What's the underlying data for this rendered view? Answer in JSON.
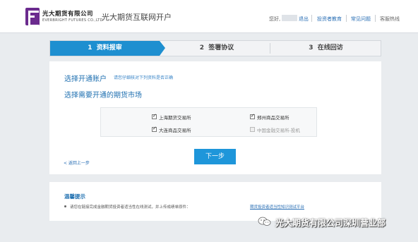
{
  "header": {
    "logo_cn": "光大期货有限公司",
    "logo_en": "EVERBRIGHT FUTURES CO.,LTD",
    "site_title": "光大期货互联网开户",
    "greeting": "您好,",
    "logout": "退出",
    "investor_edu": "投资者教育",
    "faq": "常见问题",
    "hotline": "客服热线"
  },
  "steps": [
    {
      "num": "1",
      "label": "资料报审",
      "active": true
    },
    {
      "num": "2",
      "label": "签署协议",
      "active": false
    },
    {
      "num": "3",
      "label": "在线回访",
      "active": false
    }
  ],
  "main": {
    "select_account_title": "选择开通账户",
    "select_account_hint": "请您仔细核对下列资料是否正确",
    "market_title": "选择需要开通的期货市场",
    "markets": [
      {
        "label": "上海期货交易所",
        "checked": true,
        "disabled": false
      },
      {
        "label": "郑州商品交易所",
        "checked": true,
        "disabled": false
      },
      {
        "label": "大连商品交易所",
        "checked": true,
        "disabled": false
      },
      {
        "label": "中国金融交易所-投机",
        "checked": false,
        "disabled": true
      }
    ],
    "next_button": "下一步",
    "prev_link": "< 返回上一步"
  },
  "tips": {
    "title": "温馨提示",
    "text": "请您在链接完成金融期货投资者适当性在线测试，并上传成绩单原件：",
    "link": "期货投资者适当性知识测试平台"
  },
  "watermark": {
    "text": "光大期货有限公司深圳营业部",
    "icon": "wechat-icon"
  },
  "colors": {
    "accent": "#1e96da",
    "brand": "#6b2b8e",
    "link": "#2a6fb5"
  }
}
